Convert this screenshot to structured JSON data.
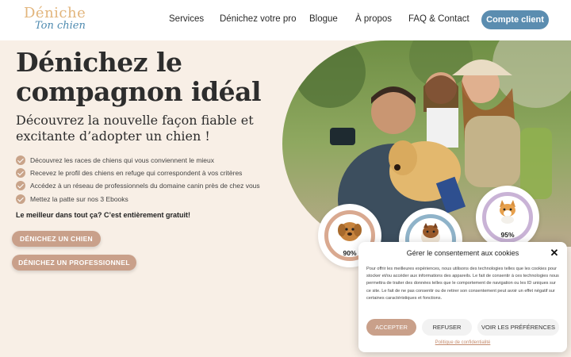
{
  "brand": {
    "logo_line1": "Déniche",
    "logo_line2": "Ton chien"
  },
  "nav": {
    "items": [
      {
        "label": "Services"
      },
      {
        "label": "Dénichez votre pro"
      },
      {
        "label": "Blogue"
      },
      {
        "label": "À propos"
      },
      {
        "label": "FAQ & Contact"
      }
    ],
    "account_button": "Compte client"
  },
  "hero": {
    "title": "Dénichez le compagnon idéal",
    "subtitle": "Découvrez la nouvelle façon fiable et excitante d’adopter un chien !",
    "bullets": [
      "Découvrez les races de chiens qui vous conviennent le mieux",
      "Recevez le profil des chiens en refuge qui correspondent à vos critères",
      "Accédez à un réseau de professionnels du domaine canin près de chez vous",
      "Mettez la patte sur nos 3 Ebooks"
    ],
    "best_line": "Le meilleur dans tout ça? C’est entièrement gratuit!",
    "button_dog": "DÉNICHEZ UN CHIEN",
    "button_pro": "DÉNICHEZ UN PROFESSIONNEL"
  },
  "stats": [
    {
      "percent": "90%",
      "ring_color": "#d9a990",
      "pet_icon": "golden-puppy-icon"
    },
    {
      "percent": "",
      "ring_color": "#8fb3c9",
      "pet_icon": "sheltie-icon"
    },
    {
      "percent": "95%",
      "ring_color": "#c9b3d6",
      "pet_icon": "corgi-icon"
    }
  ],
  "cookie": {
    "title": "Gérer le consentement aux cookies",
    "body": "Pour offrir les meilleures expériences, nous utilisons des technologies telles que les cookies pour stocker et/ou accéder aux informations des appareils. Le fait de consentir à ces technologies nous permettra de traiter des données telles que le comportement de navigation ou les ID uniques sur ce site. Le fait de ne pas consentir ou de retirer son consentement peut avoir un effet négatif sur certaines caractéristiques et fonctions.",
    "accept": "ACCEPTER",
    "refuse": "REFUSER",
    "preferences": "VOIR LES PRÉFÉRENCES",
    "policy": "Politique de confidentialité"
  },
  "colors": {
    "page_bg": "#f8efe6",
    "accent_button": "#c9a08a",
    "account_button": "#5b8db0",
    "logo_gold": "#e2b57c",
    "logo_blue": "#4f8bb0"
  }
}
